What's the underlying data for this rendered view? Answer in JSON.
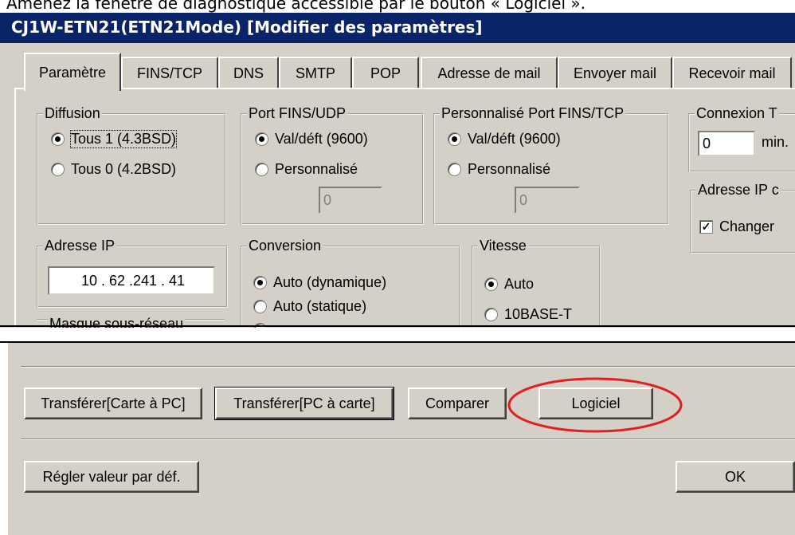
{
  "caption": "Amenez la fenêtre de diagnostique accessible par le bouton « Logiciel ».",
  "window": {
    "title": "CJ1W-ETN21(ETN21Mode) [Modifier des paramètres]"
  },
  "tabs": [
    {
      "label": "Paramètre"
    },
    {
      "label": "FINS/TCP"
    },
    {
      "label": "DNS"
    },
    {
      "label": "SMTP"
    },
    {
      "label": "POP"
    },
    {
      "label": "Adresse de mail"
    },
    {
      "label": "Envoyer mail"
    },
    {
      "label": "Recevoir mail"
    }
  ],
  "diffusion": {
    "legend": "Diffusion",
    "options": [
      {
        "label": "Tous 1 (4.3BSD)",
        "selected": true
      },
      {
        "label": "Tous 0 (4.2BSD)",
        "selected": false
      }
    ]
  },
  "port_udp": {
    "legend": "Port FINS/UDP",
    "options": [
      {
        "label": "Val/déft (9600)",
        "selected": true
      },
      {
        "label": "Personnalisé",
        "selected": false
      }
    ],
    "value": "0"
  },
  "port_tcp": {
    "legend": "Personnalisé Port FINS/TCP",
    "options": [
      {
        "label": "Val/déft (9600)",
        "selected": true
      },
      {
        "label": "Personnalisé",
        "selected": false
      }
    ],
    "value": "0"
  },
  "connexion": {
    "legend": "Connexion T",
    "value": "0",
    "unit": "min."
  },
  "adresse_ip_dyn": {
    "legend": "Adresse IP c",
    "checkbox_label": "Changer",
    "checked": true
  },
  "ip": {
    "legend": "Adresse IP",
    "value": "10 . 62 .241 . 41"
  },
  "conversion": {
    "legend": "Conversion",
    "options": [
      {
        "label": "Auto (dynamique)",
        "selected": true
      },
      {
        "label": "Auto (statique)",
        "selected": false
      }
    ]
  },
  "vitesse": {
    "legend": "Vitesse",
    "options": [
      {
        "label": "Auto",
        "selected": true
      },
      {
        "label": "10BASE-T",
        "selected": false
      }
    ]
  },
  "masque": {
    "legend": "Masque sous-réseau"
  },
  "buttons": {
    "transfer_to_pc": "Transférer[Carte à PC]",
    "transfer_to_card": "Transférer[PC à carte]",
    "compare": "Comparer",
    "logiciel": "Logiciel",
    "defaults": "Régler valeur par déf.",
    "ok": "OK"
  },
  "colors": {
    "title_bar": "#0a246a",
    "face": "#d4d0c8",
    "highlight_ellipse": "#e02020"
  }
}
